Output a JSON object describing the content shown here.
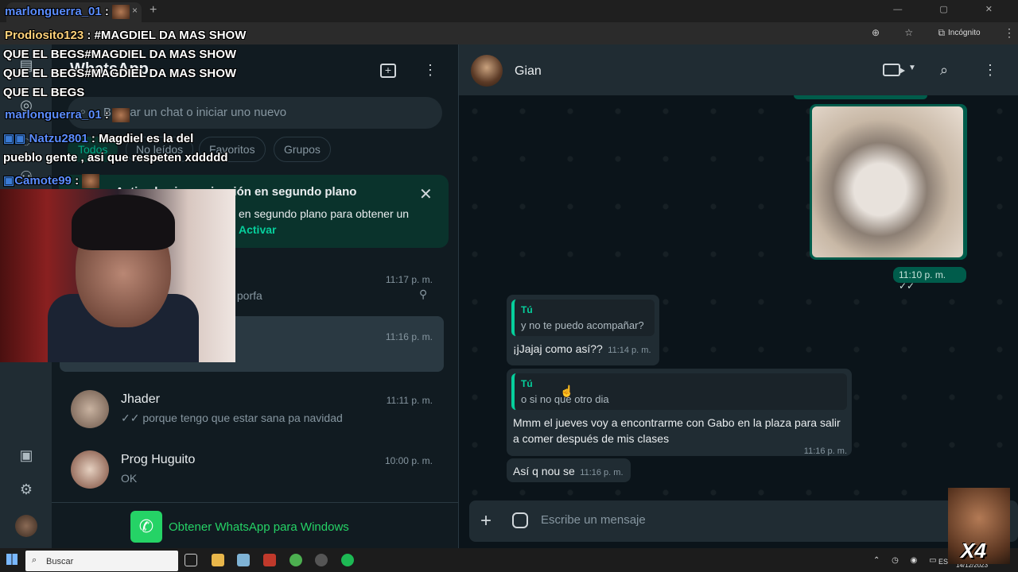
{
  "browser": {
    "new_tab": "+",
    "tab_close": "×",
    "window_controls": "— ▢ ✕",
    "addr_icons": "⊕ ☆ ⧉",
    "incognito_label": "Incógnito",
    "menu": "⋮"
  },
  "sidebar": {
    "title": "WhatsApp",
    "new_chat": "+",
    "menu": "⋮",
    "search_placeholder": "Buscar un chat o iniciar uno nuevo",
    "filters": [
      "Todos",
      "No leídos",
      "Favoritos",
      "Grupos"
    ],
    "banner": {
      "title": "Activa la sincronización en segundo plano",
      "body": "en segundo plano para obtener un",
      "action": "Activar",
      "close": "✕"
    },
    "chats": [
      {
        "time": "11:17 p. m.",
        "preview": "s porfa"
      },
      {
        "time": "11:16 p. m.",
        "preview": ""
      },
      {
        "name": "Jhader",
        "time": "11:11 p. m.",
        "preview": "✓✓ porque tengo que estar sana pa navidad"
      },
      {
        "name": "Prog Huguito",
        "time": "10:00 p. m.",
        "preview": "OK"
      }
    ],
    "get_app": "Obtener WhatsApp para Windows"
  },
  "chat": {
    "contact_name": "Gian",
    "image_time": "11:10 p. m. ✓✓",
    "messages": [
      {
        "quote_name": "Tú",
        "quote_text": "y no te puedo acompañar?",
        "text": "¡jJajaj como así??",
        "time": "11:14 p. m."
      },
      {
        "quote_name": "Tú",
        "quote_text": "o si no que otro dia",
        "text": "Mmm el jueves voy a encontrarme con Gabo en la plaza para salir a comer después de mis clases",
        "time": "11:16 p. m."
      },
      {
        "text": "Así q nou se",
        "time": "11:16 p. m."
      }
    ],
    "composer_placeholder": "Escribe un mensaje"
  },
  "taskbar": {
    "search": "Buscar",
    "lang": "ESP",
    "date": "14/12/2023"
  },
  "overlay": {
    "chat": [
      {
        "user": "marlonguerra_01",
        "text": ":"
      },
      {
        "user": "Prodiosito123",
        "text": ": #MAGDIEL DA MAS SHOW"
      },
      {
        "text": "QUE EL BEGS#MAGDIEL DA MAS SHOW"
      },
      {
        "text": "QUE EL BEGS#MAGDIEL DA MAS SHOW"
      },
      {
        "text": "QUE EL BEGS"
      },
      {
        "user": "marlonguerra_01",
        "text": ":"
      },
      {
        "user": "Natzu2801",
        "text": ": Magdiel es la del"
      },
      {
        "text": "pueblo gente , asi que respeten xddddd"
      },
      {
        "user": "Camote99",
        "text": ":"
      }
    ],
    "emote_label": "X4"
  }
}
